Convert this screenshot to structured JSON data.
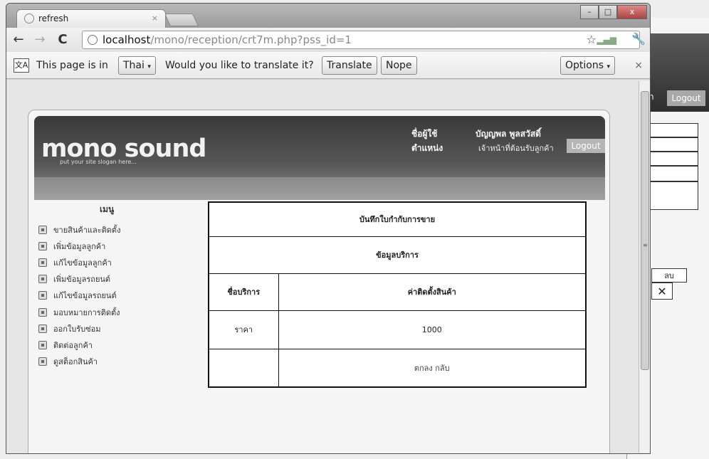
{
  "background_window": {
    "logout_label": "Logout",
    "partial_label": "n",
    "delete_header": "ลบ",
    "delete_icon": "close-icon"
  },
  "browser": {
    "tab": {
      "title": "refresh",
      "close": "×"
    },
    "window_controls": {
      "minimize": "–",
      "maximize": "□",
      "close": "x"
    },
    "address": {
      "host": "localhost",
      "path": "/mono/reception/crt7m.php?pss_id=1"
    },
    "icons": {
      "back": "back-arrow-icon",
      "forward": "forward-arrow-icon",
      "reload": "reload-icon",
      "star": "star-icon",
      "wrench": "wrench-icon"
    },
    "translate_bar": {
      "icon_text": "文A",
      "prefix": "This page is in",
      "language": "Thai",
      "question": "Would you like to translate it?",
      "translate_label": "Translate",
      "nope_label": "Nope",
      "options_label": "Options",
      "close": "×"
    }
  },
  "site": {
    "logo": "mono sound",
    "slogan": "put your site slogan here...",
    "user_label": "ชื่อผู้ใช้",
    "user_value": "บัญญพล พูลสวัสดิ์",
    "position_label": "ตำแหน่ง",
    "position_value": "เจ้าหน้าที่ต้อนรับลูกค้า",
    "logout_label": "Logout",
    "menu_title": "เมนู",
    "menu_items": [
      "ขายสินค้าและติดตั้ง",
      "เพิ่มข้อมูลลูกค้า",
      "แก้ไขข้อมูลลูกค้า",
      "เพิ่มข้อมูลรถยนต์",
      "แก้ไขข้อมูลรถยนต์",
      "มอบหมายการติดตั้ง",
      "ออกใบรับซ่อม",
      "ติดต่อลูกค้า",
      "ดูสต็อกสินค้า"
    ]
  },
  "receipt": {
    "title": "บันทึกใบกำกับการขาย",
    "section": "ข้อมูลบริการ",
    "service_name_label": "ชื่อบริการ",
    "service_name_value": "ค่าติดตั้งสินค้า",
    "price_label": "ราคา",
    "price_value": "1000",
    "back_link": "ตกลง กลับ"
  }
}
